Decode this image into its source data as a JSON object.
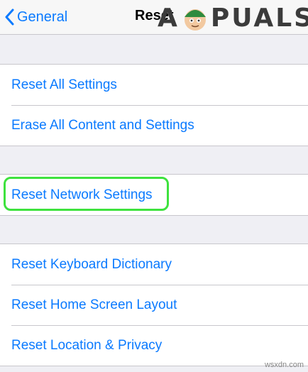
{
  "nav": {
    "back_label": "General",
    "title": "Reset"
  },
  "watermark": {
    "brand_left": "A",
    "brand_right": "PUALS",
    "site": "wsxdn.com"
  },
  "groups": [
    {
      "items": [
        "Reset All Settings",
        "Erase All Content and Settings"
      ]
    },
    {
      "items": [
        "Reset Network Settings"
      ],
      "highlighted_item": "Reset Network Settings"
    },
    {
      "items": [
        "Reset Keyboard Dictionary",
        "Reset Home Screen Layout",
        "Reset Location & Privacy"
      ]
    }
  ],
  "colors": {
    "accent": "#0a7aff",
    "highlight": "#3ee23e",
    "background": "#efeff4"
  }
}
